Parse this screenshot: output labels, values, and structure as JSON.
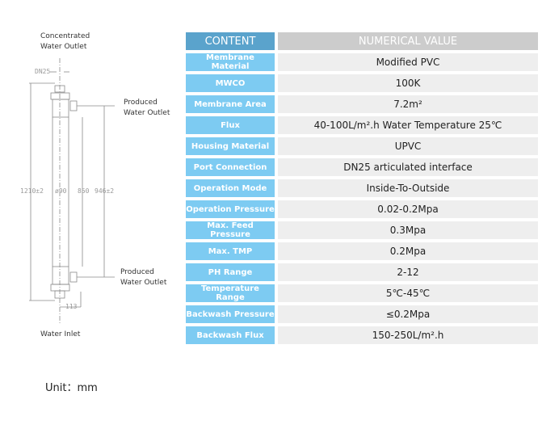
{
  "diagram": {
    "labels": {
      "concentrated_outlet_line1": "Concentrated",
      "concentrated_outlet_line2": "Water Outlet",
      "produced_outlet_top_line1": "Produced",
      "produced_outlet_top_line2": "Water Outlet",
      "produced_outlet_bottom_line1": "Produced",
      "produced_outlet_bottom_line2": "Water Outlet",
      "water_inlet": "Water Inlet"
    },
    "dimensions": {
      "port": "DN25",
      "total_length": "1210±2",
      "diameter": "ø90",
      "membrane_length": "850",
      "outlet_spacing": "946±2",
      "side_offset": "113"
    }
  },
  "table": {
    "header": {
      "content": "CONTENT",
      "value": "NUMERICAL VALUE"
    },
    "rows": [
      {
        "key": "Membrane Material",
        "value": "Modified PVC"
      },
      {
        "key": "MWCO",
        "value": "100K"
      },
      {
        "key": "Membrane Area",
        "value": "7.2m²"
      },
      {
        "key": "Flux",
        "value": "40-100L/m².h   Water Temperature 25℃"
      },
      {
        "key": "Housing Material",
        "value": "UPVC"
      },
      {
        "key": "Port Connection",
        "value": "DN25 articulated interface"
      },
      {
        "key": "Operation Mode",
        "value": "Inside-To-Outside"
      },
      {
        "key": "Operation Pressure",
        "value": "0.02-0.2Mpa"
      },
      {
        "key": "Max. Feed Pressure",
        "value": "0.3Mpa"
      },
      {
        "key": "Max. TMP",
        "value": "0.2Mpa"
      },
      {
        "key": "PH Range",
        "value": "2-12"
      },
      {
        "key": "Temperature Range",
        "value": "5℃-45℃"
      },
      {
        "key": "Backwash Pressure",
        "value": "≤0.2Mpa"
      },
      {
        "key": "Backwash Flux",
        "value": "150-250L/m².h"
      }
    ]
  },
  "footer": {
    "unit": "Unit：mm"
  },
  "colors": {
    "key_cell": "#7dcbf2",
    "header_key": "#5aa3cc",
    "header_value": "#cccccc",
    "value_cell": "#eeeeee"
  }
}
